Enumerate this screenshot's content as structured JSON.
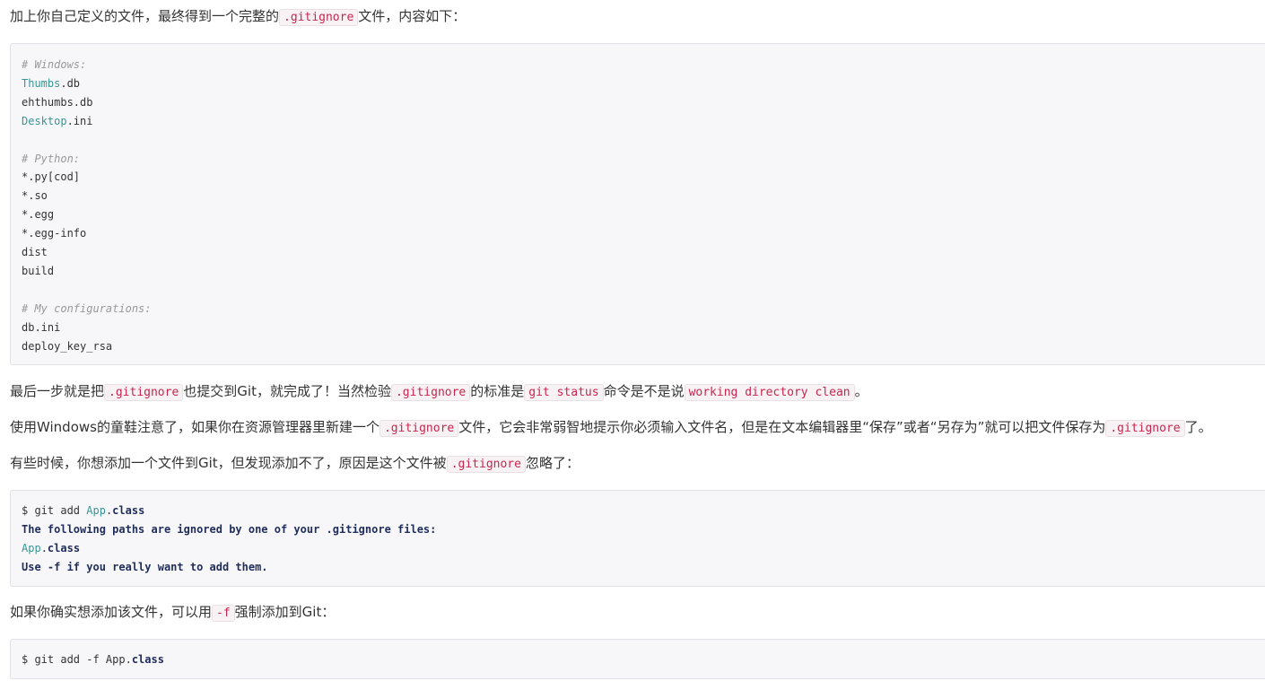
{
  "p1": {
    "before": "加上你自己定义的文件，最终得到一个完整的",
    "code": ".gitignore",
    "after": "文件，内容如下："
  },
  "gitignore_block": {
    "lines": [
      [
        {
          "t": "# Windows:",
          "c": "cm"
        }
      ],
      [
        {
          "t": "Thumbs",
          "c": "tl"
        },
        {
          "t": ".db",
          "c": ""
        }
      ],
      [
        {
          "t": "ehthumbs.db",
          "c": ""
        }
      ],
      [
        {
          "t": "Desktop",
          "c": "tl"
        },
        {
          "t": ".ini",
          "c": ""
        }
      ],
      [],
      [
        {
          "t": "# Python:",
          "c": "cm"
        }
      ],
      [
        {
          "t": "*.py[cod]",
          "c": ""
        }
      ],
      [
        {
          "t": "*.so",
          "c": ""
        }
      ],
      [
        {
          "t": "*.egg",
          "c": ""
        }
      ],
      [
        {
          "t": "*.egg-info",
          "c": ""
        }
      ],
      [
        {
          "t": "dist",
          "c": ""
        }
      ],
      [
        {
          "t": "build",
          "c": ""
        }
      ],
      [],
      [
        {
          "t": "# My configurations:",
          "c": "cm"
        }
      ],
      [
        {
          "t": "db.ini",
          "c": ""
        }
      ],
      [
        {
          "t": "deploy_key_rsa",
          "c": ""
        }
      ]
    ]
  },
  "p2": {
    "t1": "最后一步就是把",
    "c1": ".gitignore",
    "t2": "也提交到Git，就完成了！当然检验",
    "c2": ".gitignore",
    "t3": "的标准是",
    "c3": "git status",
    "t4": "命令是不是说",
    "c4": "working directory clean",
    "t5": "。"
  },
  "p3": {
    "t1": "使用Windows的童鞋注意了，如果你在资源管理器里新建一个",
    "c1": ".gitignore",
    "t2": "文件，它会非常弱智地提示你必须输入文件名，但是在文本编辑器里“保存”或者“另存为”就可以把文件保存为",
    "c2": ".gitignore",
    "t3": "了。"
  },
  "p4": {
    "t1": "有些时候，你想添加一个文件到Git，但发现添加不了，原因是这个文件被",
    "c1": ".gitignore",
    "t2": "忽略了："
  },
  "add_block": {
    "lines": [
      [
        {
          "t": "$ git add ",
          "c": ""
        },
        {
          "t": "App",
          "c": "tl"
        },
        {
          "t": ".",
          "c": ""
        },
        {
          "t": "class",
          "c": "kw"
        }
      ],
      [
        {
          "t": "The following paths are ignored by one of your .gitignore files:",
          "c": "kw"
        }
      ],
      [
        {
          "t": "App",
          "c": "tl"
        },
        {
          "t": ".",
          "c": ""
        },
        {
          "t": "class",
          "c": "kw"
        }
      ],
      [
        {
          "t": "Use -f if you really want to add them.",
          "c": "kw"
        }
      ]
    ]
  },
  "p5": {
    "t1": "如果你确实想添加该文件，可以用",
    "c1": "-f",
    "t2": "强制添加到Git："
  },
  "force_block": {
    "lines": [
      [
        {
          "t": "$ git add -f App.",
          "c": ""
        },
        {
          "t": "class",
          "c": "kw"
        }
      ]
    ]
  }
}
